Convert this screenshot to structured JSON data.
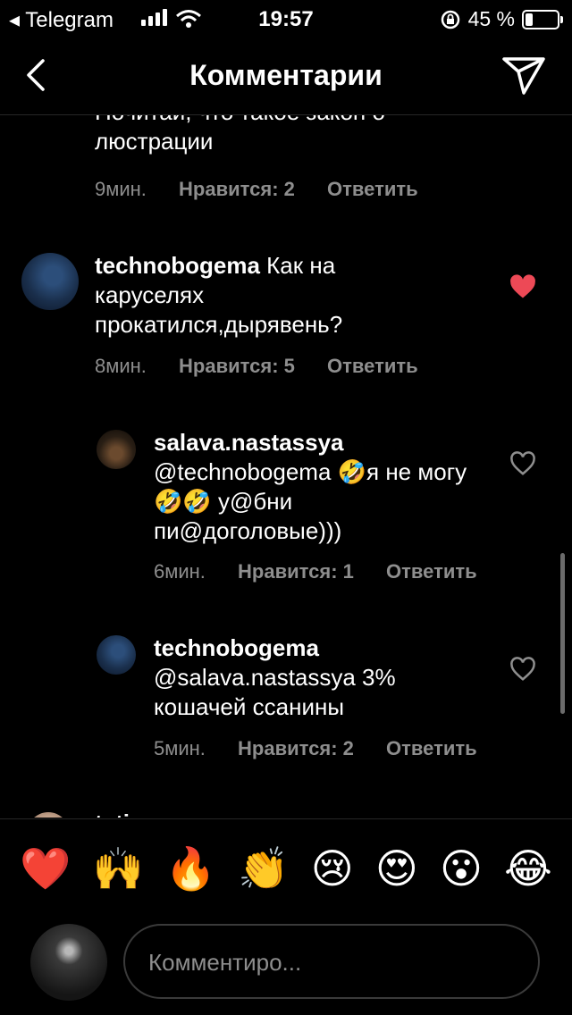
{
  "status_bar": {
    "carrier": "◂ Telegram",
    "time": "19:57",
    "battery": "45 %"
  },
  "header": {
    "title": "Комментарии"
  },
  "comments": [
    {
      "text": "Почитай, что такое закон о люстрации",
      "age": "9мин.",
      "likes": "Нравится: 2",
      "reply": "Ответить"
    },
    {
      "user": "technobogema",
      "text": " Как на каруселях прокатился,дырявень?",
      "age": "8мин.",
      "likes": "Нравится: 5",
      "reply": "Ответить",
      "liked": true
    },
    {
      "user": "salava.nastassya",
      "text": "@technobogema 🤣я не могу🤣🤣 у@бни пи@доголовые)))",
      "age": "6мин.",
      "likes": "Нравится: 1",
      "reply": "Ответить",
      "liked": false
    },
    {
      "user": "technobogema",
      "text": "@salava.nastassya 3% кошачей ссанины",
      "age": "5мин.",
      "likes": "Нравится: 2",
      "reply": "Ответить",
      "liked": false
    },
    {
      "user": "tatiana...",
      "text": ""
    }
  ],
  "quick_emojis": [
    "❤️",
    "🙌",
    "🔥",
    "👏",
    "😢",
    "😍",
    "😮",
    "😂"
  ],
  "composer": {
    "placeholder": "Комментиро..."
  },
  "colors": {
    "accent_heart": "#ed4956",
    "muted": "#8e8e8e",
    "divider": "#262626"
  }
}
